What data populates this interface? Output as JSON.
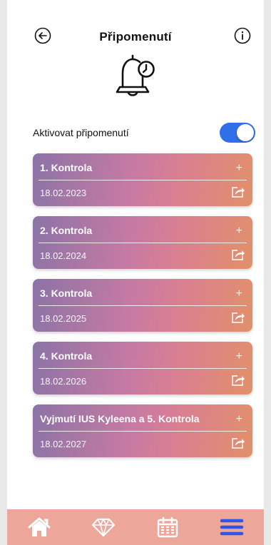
{
  "header": {
    "title": "Připomenutí",
    "back_icon": "back-arrow-circle-icon",
    "info_icon": "info-circle-icon"
  },
  "bell_icon": "bell-clock-icon",
  "reminder_toggle": {
    "label": "Aktivovat připomenutí",
    "enabled": true,
    "accent_color": "#2f6fe8"
  },
  "cards": [
    {
      "title": "1. Kontrola",
      "date": "18.02.2023"
    },
    {
      "title": "2. Kontrola",
      "date": "18.02.2024"
    },
    {
      "title": "3. Kontrola",
      "date": "18.02.2025"
    },
    {
      "title": "4. Kontrola",
      "date": "18.02.2026"
    },
    {
      "title": "Vyjmutí IUS Kyleena a 5. Kontrola",
      "date": "18.02.2027"
    }
  ],
  "card_actions": {
    "add": "+",
    "share_icon": "share-icon"
  },
  "tabbar": {
    "background": "#eca79a",
    "items": [
      {
        "icon": "home-icon",
        "active": false
      },
      {
        "icon": "diamond-icon",
        "active": false
      },
      {
        "icon": "calendar-icon",
        "active": false
      },
      {
        "icon": "menu-icon",
        "active": true
      }
    ]
  }
}
